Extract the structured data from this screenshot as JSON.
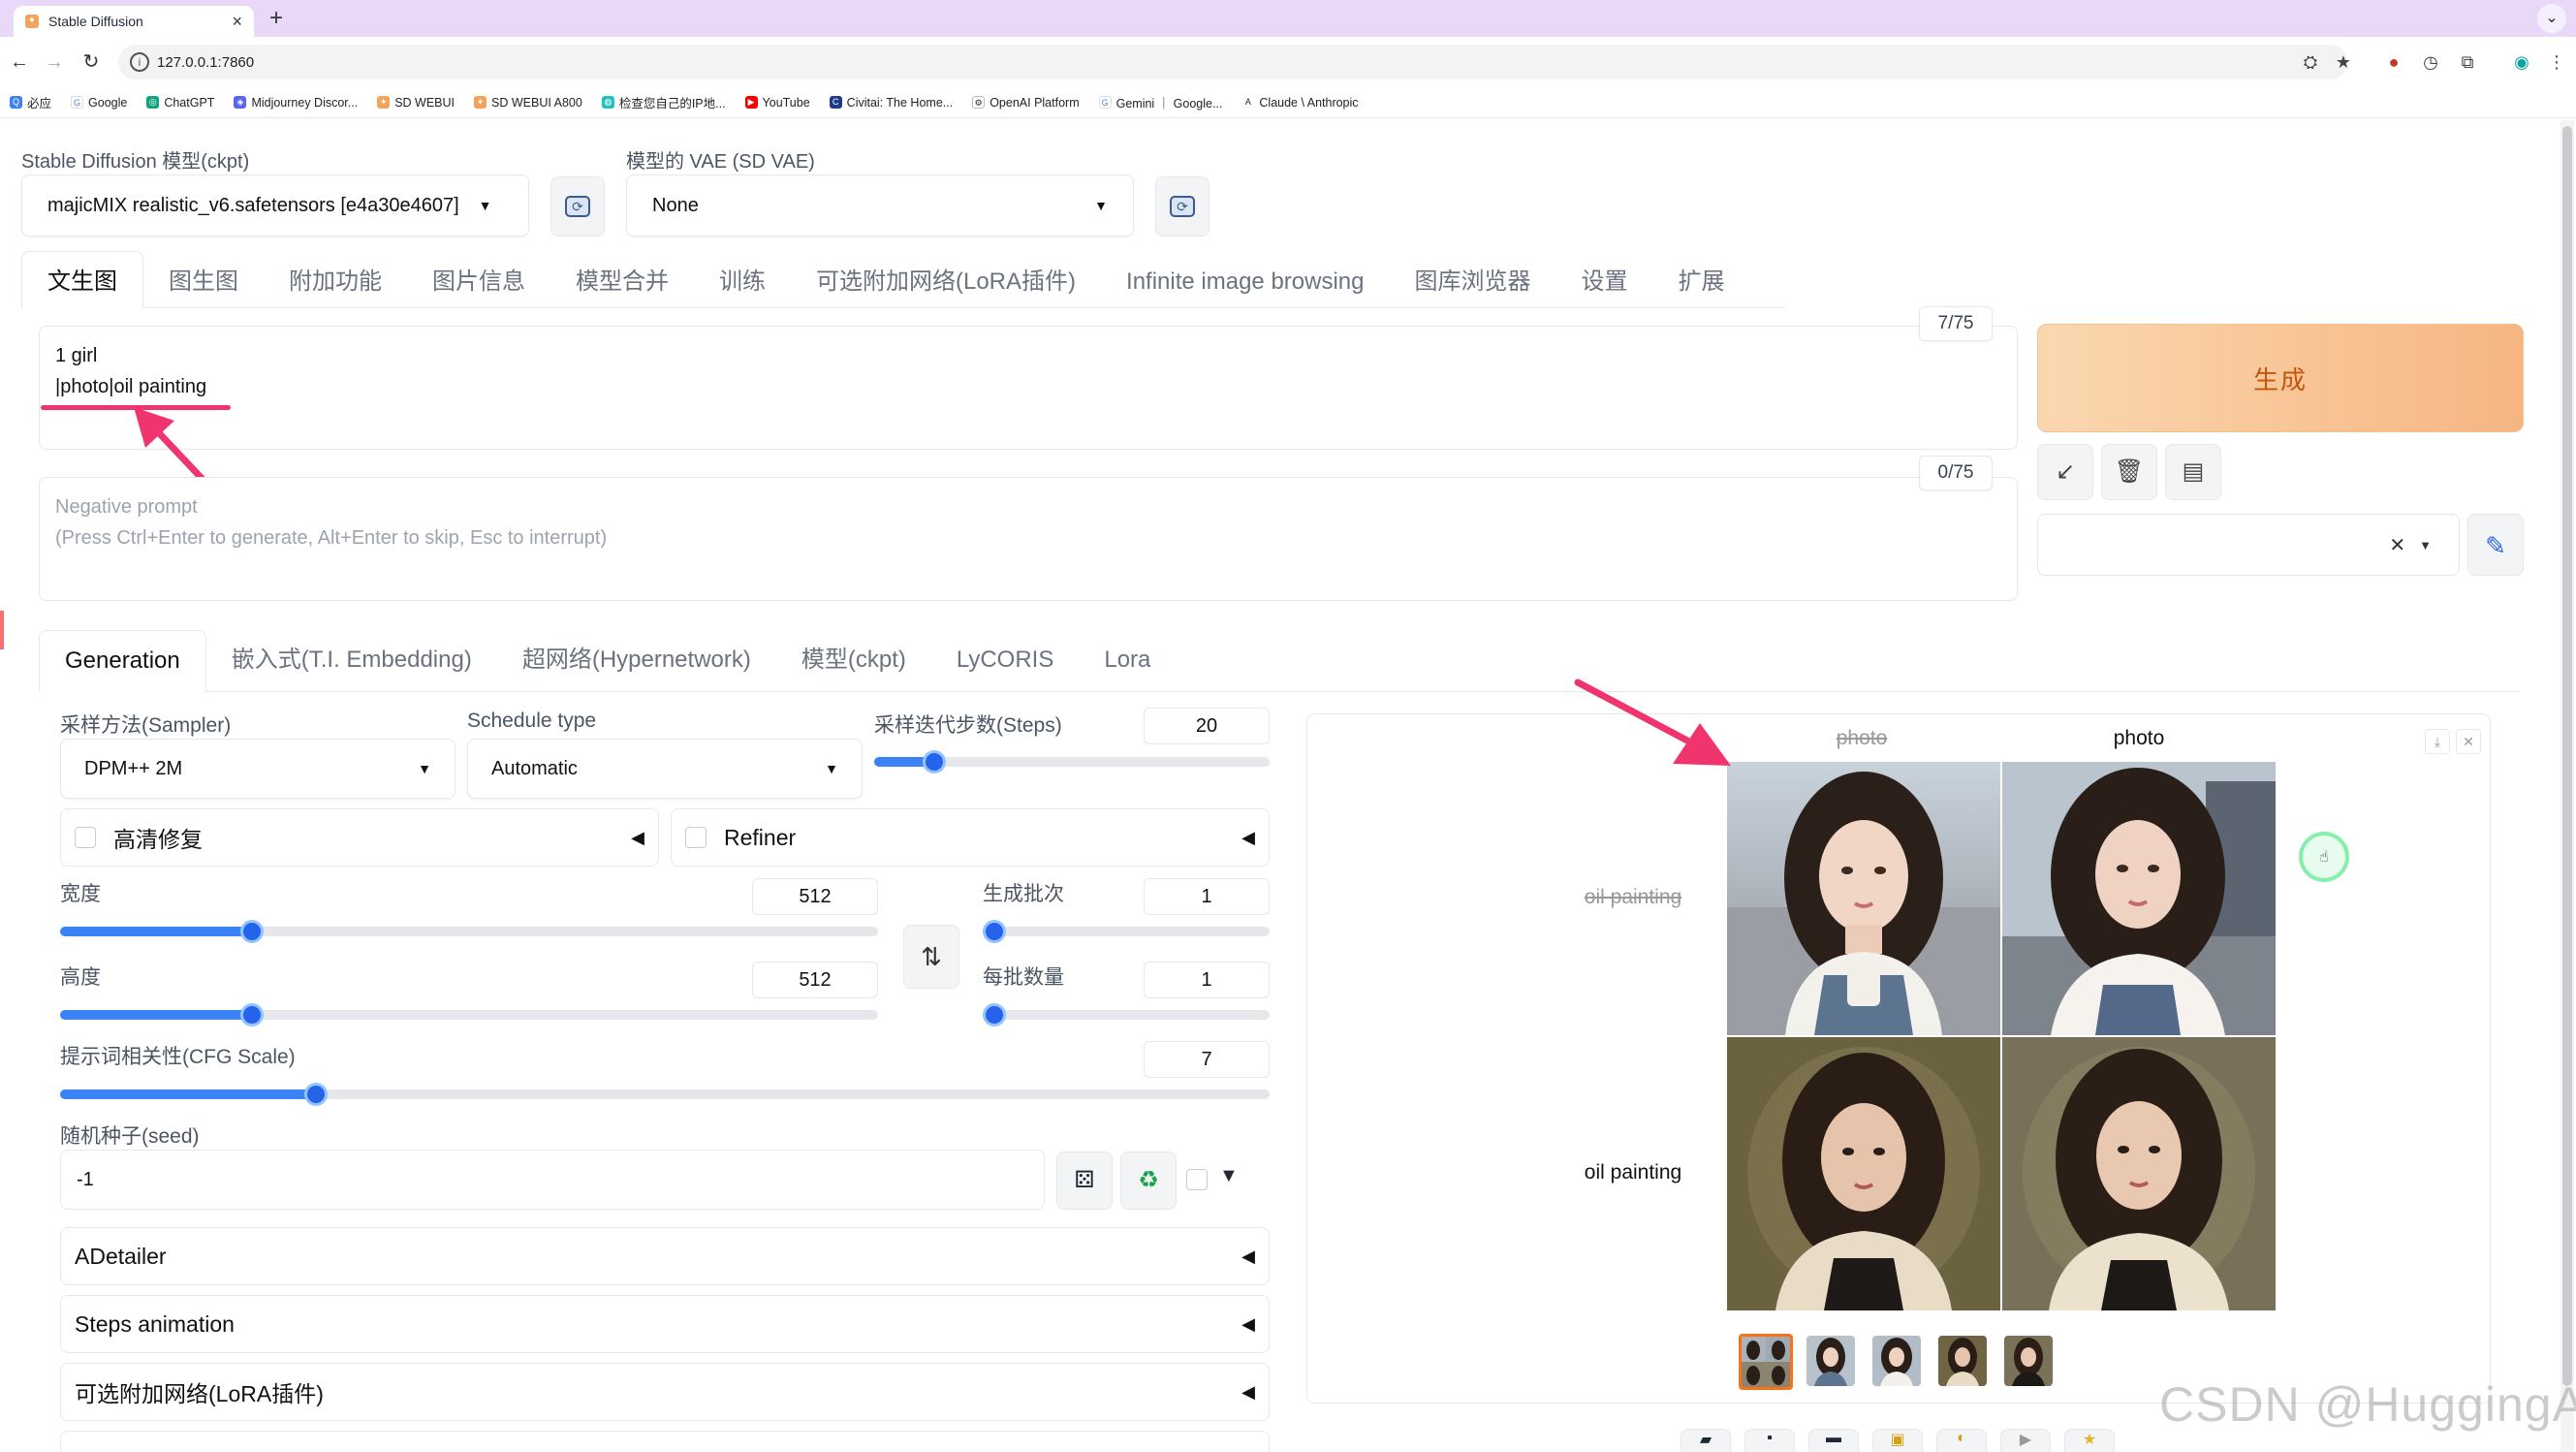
{
  "browser": {
    "tab_title": "Stable Diffusion",
    "url": "127.0.0.1:7860",
    "bookmarks": [
      "必应",
      "Google",
      "ChatGPT",
      "Midjourney Discor...",
      "SD WEBUI",
      "SD WEBUI A800",
      "检查您自己的IP地...",
      "YouTube",
      "Civitai: The Home...",
      "OpenAI Platform",
      "Gemini ｜ Google...",
      "Claude \\ Anthropic"
    ]
  },
  "model": {
    "ckpt_label": "Stable Diffusion 模型(ckpt)",
    "ckpt_value": "majicMIX realistic_v6.safetensors [e4a30e4607]",
    "vae_label": "模型的 VAE (SD VAE)",
    "vae_value": "None"
  },
  "main_tabs": [
    "文生图",
    "图生图",
    "附加功能",
    "图片信息",
    "模型合并",
    "训练",
    "可选附加网络(LoRA插件)",
    "Infinite image browsing",
    "图库浏览器",
    "设置",
    "扩展"
  ],
  "prompt": {
    "line1": "1 girl",
    "line2": "|photo|oil painting",
    "counter": "7/75"
  },
  "negative": {
    "placeholder_line1": "Negative prompt",
    "placeholder_line2": "(Press Ctrl+Enter to generate, Alt+Enter to skip, Esc to interrupt)",
    "counter": "0/75"
  },
  "generate_label": "生成",
  "tool_icons": [
    "arrow-icon",
    "trash-icon",
    "clipboard-icon"
  ],
  "sub_tabs": [
    "Generation",
    "嵌入式(T.I. Embedding)",
    "超网络(Hypernetwork)",
    "模型(ckpt)",
    "LyCORIS",
    "Lora"
  ],
  "params": {
    "sampler_label": "采样方法(Sampler)",
    "sampler_value": "DPM++ 2M",
    "schedule_label": "Schedule type",
    "schedule_value": "Automatic",
    "steps_label": "采样迭代步数(Steps)",
    "steps_value": "20",
    "hires_label": "高清修复",
    "refiner_label": "Refiner",
    "width_label": "宽度",
    "width_value": "512",
    "height_label": "高度",
    "height_value": "512",
    "batch_count_label": "生成批次",
    "batch_count_value": "1",
    "batch_size_label": "每批数量",
    "batch_size_value": "1",
    "cfg_label": "提示词相关性(CFG Scale)",
    "cfg_value": "7",
    "seed_label": "随机种子(seed)",
    "seed_value": "-1"
  },
  "accordions": [
    "ADetailer",
    "Steps animation",
    "可选附加网络(LoRA插件)"
  ],
  "grid": {
    "col_headers": [
      "photo",
      "photo"
    ],
    "row_headers": [
      "oil painting",
      "oil painting"
    ]
  },
  "watermark": "CSDN @HuggingAI",
  "colors": {
    "accent": "#3b82f6",
    "generate": "#f6b581",
    "annotation": "#f0356e"
  }
}
